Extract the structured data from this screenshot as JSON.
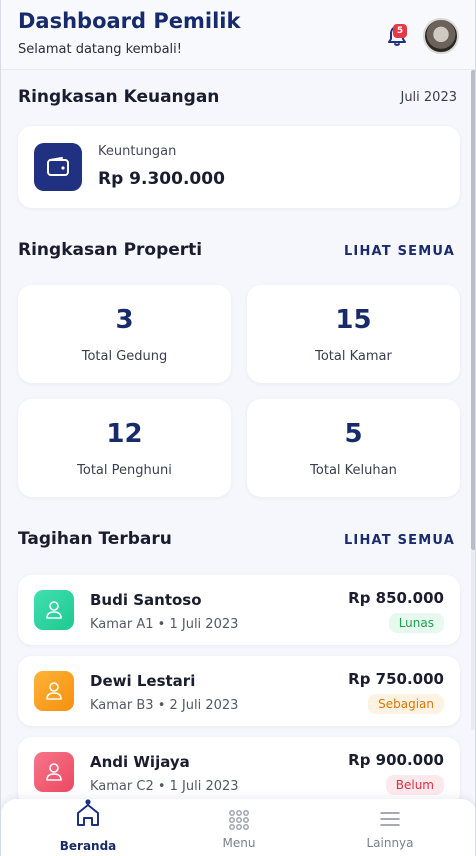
{
  "header": {
    "title": "Dashboard Pemilik",
    "subtitle": "Selamat datang kembali!",
    "notification_count": "5",
    "bell_icon": "bell-icon",
    "avatar_icon": "profile-avatar"
  },
  "finance": {
    "section_title": "Ringkasan Keuangan",
    "period": "Juli 2023",
    "card_label": "Keuntungan",
    "card_value": "Rp 9.300.000",
    "icon": "wallet-icon"
  },
  "property": {
    "section_title": "Ringkasan Properti",
    "see_all": "LIHAT SEMUA",
    "stats": [
      {
        "value": "3",
        "label": "Total Gedung"
      },
      {
        "value": "15",
        "label": "Total Kamar"
      },
      {
        "value": "12",
        "label": "Total Penghuni"
      },
      {
        "value": "5",
        "label": "Total Keluhan"
      }
    ]
  },
  "bills": {
    "section_title": "Tagihan Terbaru",
    "see_all": "LIHAT SEMUA",
    "items": [
      {
        "name": "Budi Santoso",
        "meta": "Kamar A1 • 1 Juli 2023",
        "amount": "Rp 850.000",
        "status": "Lunas",
        "icon_color": "#34d399",
        "status_color": "#16a34a",
        "status_bg": "#e7f8ee"
      },
      {
        "name": "Dewi Lestari",
        "meta": "Kamar B3 • 2 Juli 2023",
        "amount": "Rp 750.000",
        "status": "Sebagian",
        "icon_color": "#fb9f1c",
        "status_color": "#d97706",
        "status_bg": "#fef3e2"
      },
      {
        "name": "Andi Wijaya",
        "meta": "Kamar C2 • 1 Juli 2023",
        "amount": "Rp 900.000",
        "status": "Belum",
        "icon_color": "#f05a6e",
        "status_color": "#dc2f44",
        "status_bg": "#fde8eb"
      }
    ]
  },
  "nav": {
    "items": [
      {
        "label": "Beranda",
        "icon": "home-icon",
        "active": true
      },
      {
        "label": "Menu",
        "icon": "grid-icon",
        "active": false
      },
      {
        "label": "Lainnya",
        "icon": "menu-lines-icon",
        "active": false
      }
    ]
  },
  "colors": {
    "primary": "#172a6b",
    "background": "#f5f7fc",
    "card": "#ffffff"
  }
}
